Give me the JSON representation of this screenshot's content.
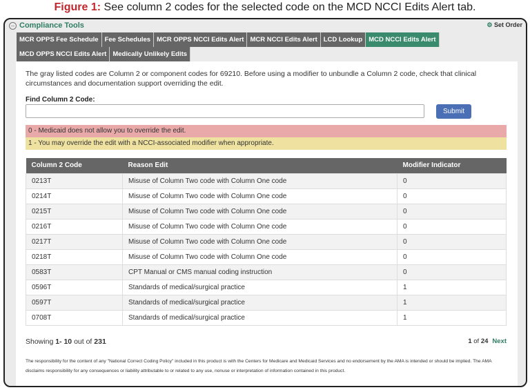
{
  "figure": {
    "label": "Figure 1:",
    "caption": "See column 2 codes for the selected code on the MCD NCCI Edits Alert tab."
  },
  "header": {
    "title": "Compliance Tools",
    "collapse_icon": "minus-circle-icon",
    "set_order": "Set Order",
    "gear_icon": "gear-icon"
  },
  "tabs": [
    {
      "label": "MCR OPPS Fee Schedule"
    },
    {
      "label": "Fee Schedules"
    },
    {
      "label": "MCR OPPS NCCI Edits Alert"
    },
    {
      "label": "MCR NCCI Edits Alert"
    },
    {
      "label": "LCD Lookup"
    },
    {
      "label": "MCD NCCI Edits Alert",
      "active": true
    },
    {
      "label": "MCD OPPS NCCI Edits Alert"
    },
    {
      "label": "Medically Unlikely Edits"
    }
  ],
  "intro": "The gray listed codes are Column 2 or component codes for 69210. Before using a modifier to unbundle a Column 2 code, check that clinical circumstances and documentation support overriding the edit.",
  "find": {
    "label": "Find Column 2 Code:",
    "value": "",
    "submit": "Submit"
  },
  "legend": {
    "red": "0 - Medicaid does not allow you to override the edit.",
    "yellow": "1 - You may override the edit with a NCCI-associated modifier when appropriate."
  },
  "table": {
    "headers": [
      "Column 2 Code",
      "Reason Edit",
      "Modifier Indicator"
    ],
    "rows": [
      [
        "0213T",
        "Misuse of Column Two code with Column One code",
        "0"
      ],
      [
        "0214T",
        "Misuse of Column Two code with Column One code",
        "0"
      ],
      [
        "0215T",
        "Misuse of Column Two code with Column One code",
        "0"
      ],
      [
        "0216T",
        "Misuse of Column Two code with Column One code",
        "0"
      ],
      [
        "0217T",
        "Misuse of Column Two code with Column One code",
        "0"
      ],
      [
        "0218T",
        "Misuse of Column Two code with Column One code",
        "0"
      ],
      [
        "0583T",
        "CPT Manual or CMS manual coding instruction",
        "0"
      ],
      [
        "0596T",
        "Standards of medical/surgical practice",
        "1"
      ],
      [
        "0597T",
        "Standards of medical/surgical practice",
        "1"
      ],
      [
        "0708T",
        "Standards of medical/surgical practice",
        "1"
      ]
    ]
  },
  "paging": {
    "showing": "Showing",
    "range": "1- 10",
    "out_of": "out of",
    "total": "231",
    "page": "1",
    "of": "of",
    "pages": "24",
    "next": "Next"
  },
  "footnote": "The responsibility for the content of any \"National Correct Coding Policy\" included in this product is with the Centers for Medicare and Medicaid Services and no endorsement by the AMA is intended or should be implied. The AMA disclaims responsibility for any consequences or liability attributable to or related to any use, nonuse or interpretation of information contained in this product.",
  "colors": {
    "accent": "#3a8a6e",
    "submit": "#4a6fb5",
    "red": "#e9a9a9",
    "yellow": "#efe2a0"
  }
}
